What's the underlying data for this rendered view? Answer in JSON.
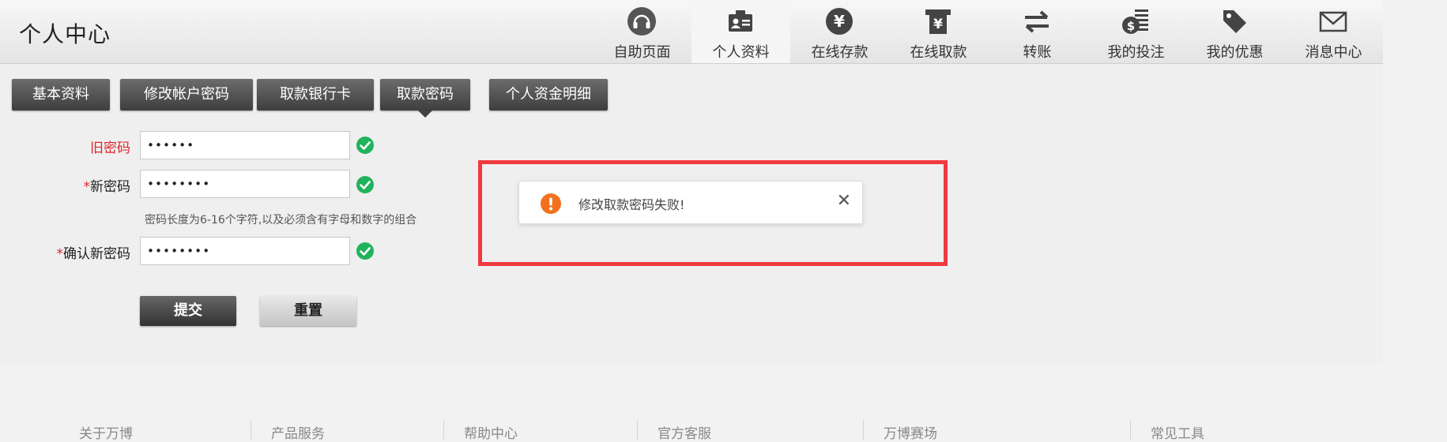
{
  "header": {
    "title": "个人中心"
  },
  "nav": [
    {
      "label": "自助页面",
      "icon": "headset-icon"
    },
    {
      "label": "个人资料",
      "icon": "id-card-icon",
      "active": true
    },
    {
      "label": "在线存款",
      "icon": "yen-coin-icon"
    },
    {
      "label": "在线取款",
      "icon": "atm-withdraw-icon"
    },
    {
      "label": "转账",
      "icon": "transfer-arrows-icon"
    },
    {
      "label": "我的投注",
      "icon": "money-bag-icon"
    },
    {
      "label": "我的优惠",
      "icon": "price-tag-icon"
    },
    {
      "label": "消息中心",
      "icon": "envelope-icon"
    }
  ],
  "subtabs": [
    {
      "label": "基本资料"
    },
    {
      "label": "修改帐户密码"
    },
    {
      "label": "取款银行卡"
    },
    {
      "label": "取款密码",
      "active": true
    },
    {
      "label": "个人资金明细"
    }
  ],
  "form": {
    "old_password": {
      "label": "旧密码",
      "value": "••••••"
    },
    "new_password": {
      "required_mark": "*",
      "label": "新密码",
      "value": "••••••••"
    },
    "hint": "密码长度为6-16个字符,以及必须含有字母和数字的组合",
    "confirm_password": {
      "required_mark": "*",
      "label": "确认新密码",
      "value": "••••••••"
    },
    "submit_label": "提交",
    "reset_label": "重置"
  },
  "toast": {
    "message": "修改取款密码失败!",
    "icon": "warning-icon",
    "close_symbol": "✕"
  },
  "footer": [
    "关于万博",
    "产品服务",
    "帮助中心",
    "官方客服",
    "万博赛场",
    "常见工具"
  ],
  "colors": {
    "error_red": "#e0262b",
    "success_green": "#21b35c",
    "warning_orange": "#f2711c",
    "highlight_border": "#ef3a3f",
    "button_dark": "#3e3e3e"
  }
}
